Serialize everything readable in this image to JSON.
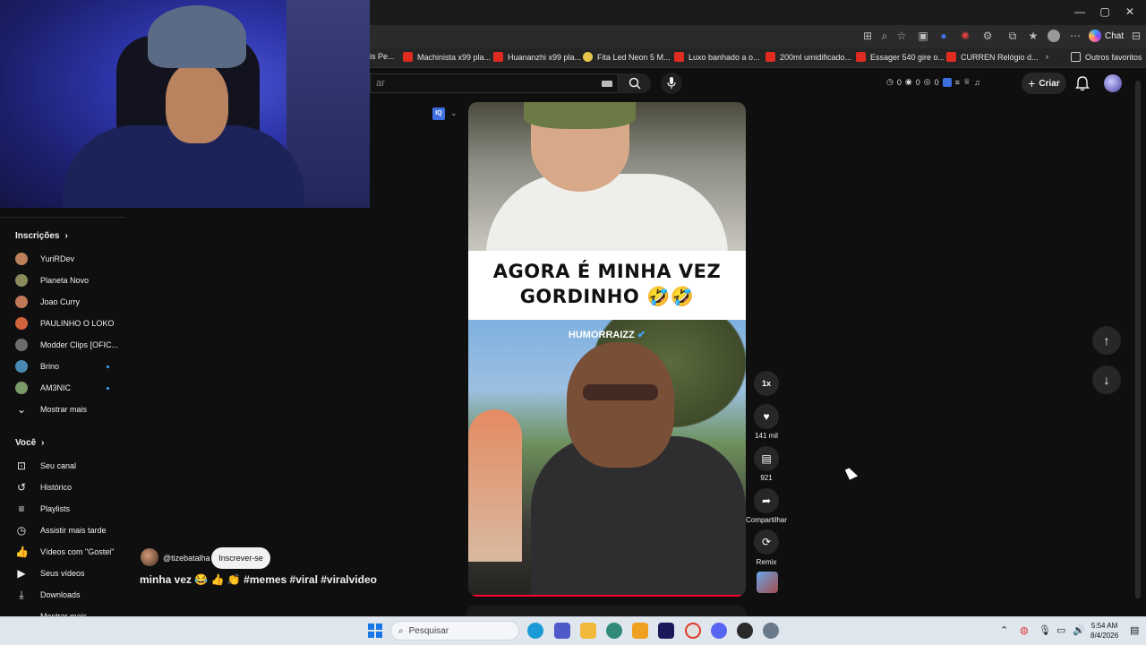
{
  "browser": {
    "window_controls": [
      "—",
      "▢",
      "✕"
    ],
    "chat_label": "Chat",
    "bookmarks": [
      {
        "label": "is Pe...",
        "icon": "shop-icon"
      },
      {
        "label": "Machinista x99 pla...",
        "icon": "shop-icon"
      },
      {
        "label": "Huananzhi x99 pla...",
        "icon": "shop-icon"
      },
      {
        "label": "Fita Led Neon 5 M...",
        "icon": "shop-icon-yellow"
      },
      {
        "label": "Luxo banhado a o...",
        "icon": "shop-icon"
      },
      {
        "label": "200ml umidificado...",
        "icon": "shop-icon"
      },
      {
        "label": "Essager 540 gire o...",
        "icon": "shop-icon"
      },
      {
        "label": "CURREN Relógio d...",
        "icon": "shop-icon"
      }
    ],
    "bookmarks_more": "›",
    "other_favorites": "Outros favoritos"
  },
  "youtube": {
    "search_placeholder": "ar",
    "ext_counters": [
      "0",
      "0",
      "0"
    ],
    "create_label": "Criar",
    "sidebar": {
      "subscriptions_heading": "Inscrições",
      "subscriptions": [
        {
          "name": "YuriRDev",
          "color": "#b9805a",
          "new": false
        },
        {
          "name": "Planeta Novo",
          "color": "#8a8a5a",
          "new": false
        },
        {
          "name": "Joao Curry",
          "color": "#c07a5a",
          "new": false
        },
        {
          "name": "PAULINHO O LOKO",
          "color": "#d1643c",
          "new": false
        },
        {
          "name": "Modder Clips [OFIC...",
          "color": "#6c6c6c",
          "new": false
        },
        {
          "name": "Brino",
          "color": "#4a8ab0",
          "new": true
        },
        {
          "name": "AM3NIC",
          "color": "#7a9a6a",
          "new": true
        }
      ],
      "show_more": "Mostrar mais",
      "you_heading": "Você",
      "you_items": [
        {
          "label": "Seu canal",
          "icon": "channel-icon"
        },
        {
          "label": "Histórico",
          "icon": "history-icon"
        },
        {
          "label": "Playlists",
          "icon": "playlists-icon"
        },
        {
          "label": "Assistir mais tarde",
          "icon": "watch-later-icon"
        },
        {
          "label": "Vídeos com \"Gostei\"",
          "icon": "like-icon"
        },
        {
          "label": "Seus vídeos",
          "icon": "your-videos-icon"
        },
        {
          "label": "Downloads",
          "icon": "download-icon"
        },
        {
          "label": "Mostrar mais",
          "icon": "chevron-down-icon"
        }
      ]
    },
    "short": {
      "caption_line1": "AGORA É MINHA VEZ",
      "caption_line2": "GORDINHO 🤣🤣",
      "watermark": "HUMORRAIZZ",
      "channel": "@tizebatalha",
      "subscribe_label": "Inscrever-se",
      "title": "minha vez 😂 👍 👏 #memes #viral #viralvideo",
      "speed_label": "1x",
      "likes": "141 mil",
      "comments": "921",
      "share_label": "Compartilhar",
      "remix_label": "Remix",
      "iq_badge": "IQ"
    }
  },
  "taskbar": {
    "search_placeholder": "Pesquisar",
    "time": "5:54 AM",
    "date": "8/4/2026"
  }
}
